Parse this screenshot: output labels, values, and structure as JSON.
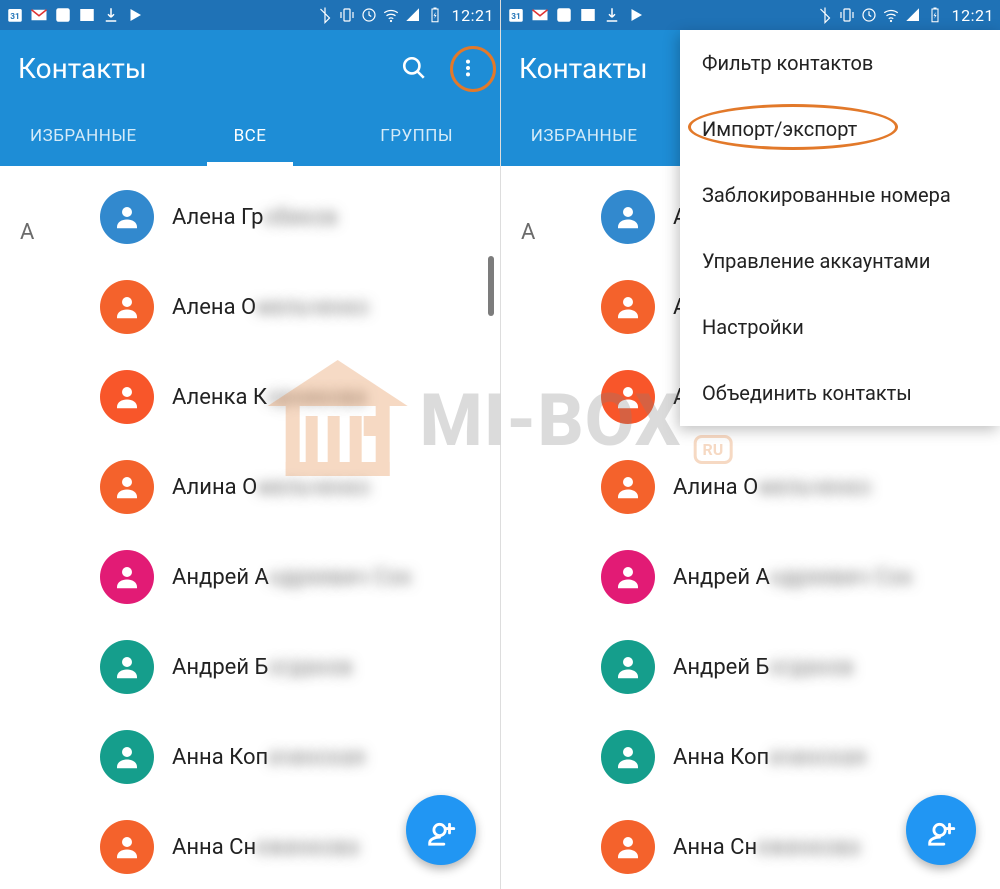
{
  "status": {
    "time": "12:21"
  },
  "app": {
    "title": "Контакты"
  },
  "tabs": {
    "favorites": "ИЗБРАННЫЕ",
    "all": "ВСЕ",
    "groups": "ГРУППЫ",
    "active": "all"
  },
  "section_letter": "А",
  "contacts": [
    {
      "name_visible": "Алена Гр",
      "name_blur": "обиков",
      "color": "c-blue"
    },
    {
      "name_visible": "Алена О",
      "name_blur": "мельченко",
      "color": "c-orange"
    },
    {
      "name_visible": "Аленка К",
      "name_blur": "орникова",
      "color": "c-orange2"
    },
    {
      "name_visible": "Алина О",
      "name_blur": "мельченко",
      "color": "c-orange"
    },
    {
      "name_visible": "Андрей А",
      "name_blur": "ндреевич Сок",
      "color": "c-pink"
    },
    {
      "name_visible": "Андрей Б",
      "name_blur": "огданов",
      "color": "c-teal"
    },
    {
      "name_visible": "Анна Коп",
      "name_blur": "ачинская",
      "color": "c-teal"
    },
    {
      "name_visible": "Анна Сн",
      "name_blur": "ежинкова",
      "color": "c-orange"
    }
  ],
  "menu": {
    "filter": "Фильтр контактов",
    "import": "Импорт/экспорт",
    "blocked": "Заблокированные номера",
    "accounts": "Управление аккаунтами",
    "settings": "Настройки",
    "merge": "Объединить контакты"
  },
  "watermark": {
    "text": "MI-BOX",
    "suffix": "RU"
  }
}
